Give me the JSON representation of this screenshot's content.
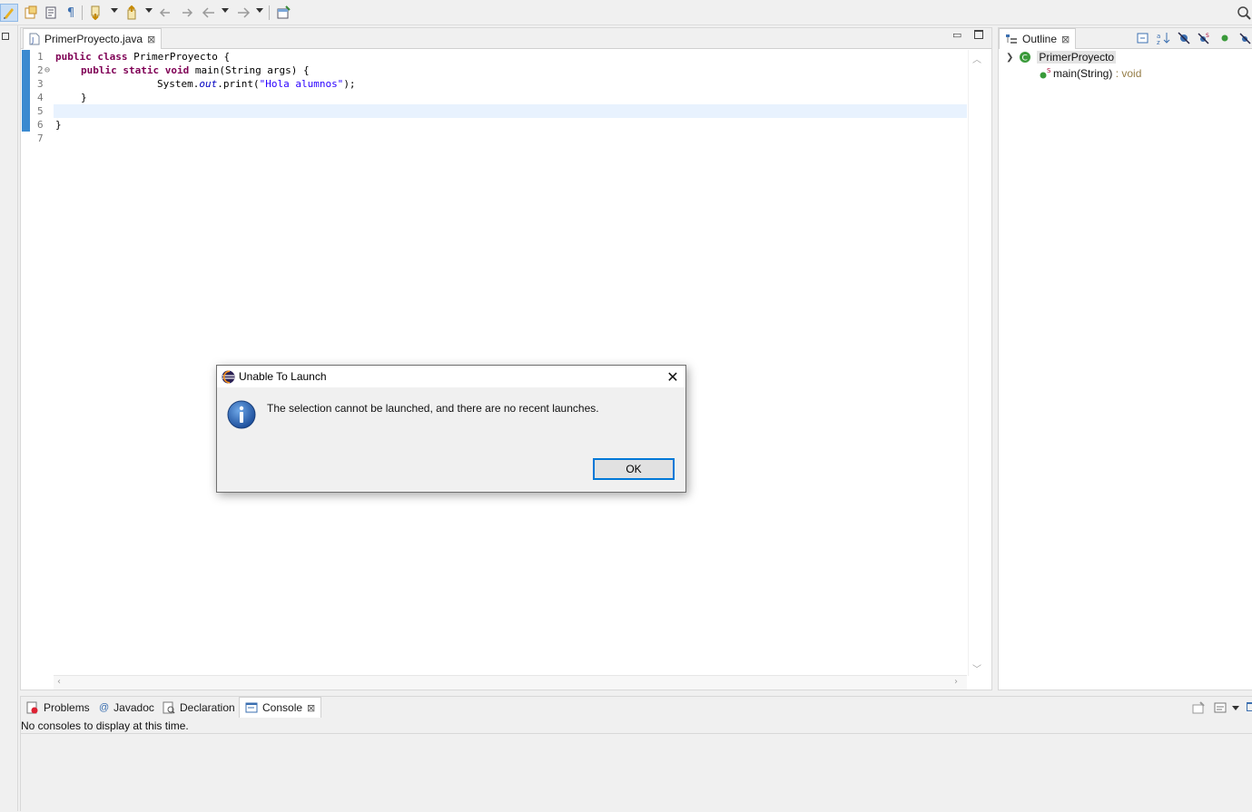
{
  "editor": {
    "tab_label": "PrimerProyecto.java",
    "code_lines": [
      {
        "num": "1",
        "fold": ""
      },
      {
        "num": "2",
        "fold": "⊖"
      },
      {
        "num": "3",
        "fold": ""
      },
      {
        "num": "4",
        "fold": ""
      },
      {
        "num": "5",
        "fold": ""
      },
      {
        "num": "6",
        "fold": ""
      },
      {
        "num": "7",
        "fold": ""
      }
    ],
    "code": {
      "l1_kw": "public class",
      "l1_rest": " PrimerProyecto {",
      "l2_kw": "public static void",
      "l2_rest": " main(String args) {",
      "l3_pre": "System.",
      "l3_field": "out",
      "l3_mid": ".print(",
      "l3_str": "\"Hola alumnos\"",
      "l3_end": ");",
      "l4": "}",
      "l6": "}"
    }
  },
  "outline": {
    "tab_label": "Outline",
    "class_name": "PrimerProyecto",
    "method_name": "main(String)",
    "method_type": " : void",
    "static_marker": "S"
  },
  "bottom": {
    "tabs": [
      {
        "label": "Problems"
      },
      {
        "label": "Javadoc"
      },
      {
        "label": "Declaration"
      },
      {
        "label": "Console"
      }
    ],
    "console_message": "No consoles to display at this time."
  },
  "dialog": {
    "title": "Unable To Launch",
    "message": "The selection cannot be launched, and there are no recent launches.",
    "ok_label": "OK"
  },
  "colors": {
    "keyword": "#7f0055",
    "string": "#2a00ff",
    "field": "#0000c0",
    "accent": "#0078d7"
  }
}
